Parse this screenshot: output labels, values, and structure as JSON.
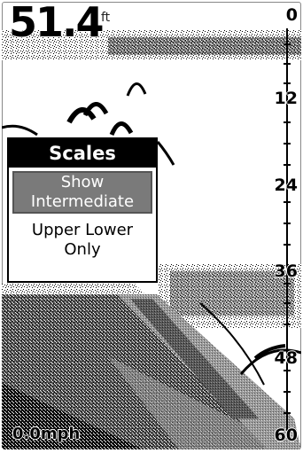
{
  "depth_readout": {
    "value": "51.4",
    "unit": "ft"
  },
  "depth_scale": [
    "0",
    "12",
    "24",
    "36",
    "48",
    "60"
  ],
  "speed_readout": "0.0mph",
  "menu": {
    "title": "Scales",
    "items": [
      {
        "label_line1": "Show",
        "label_line2": "Intermediate",
        "selected": true
      },
      {
        "label_line1": "Upper Lower",
        "label_line2": "Only",
        "selected": false
      }
    ]
  }
}
